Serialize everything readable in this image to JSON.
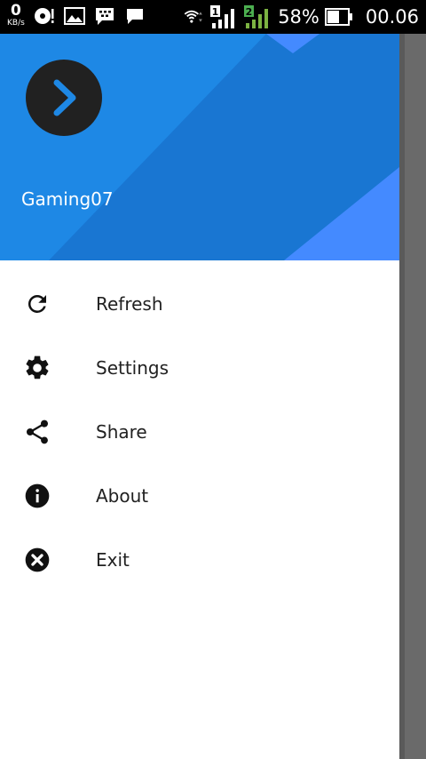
{
  "status_bar": {
    "net_speed_value": "0",
    "net_speed_unit": "KB/s",
    "sim1": "1",
    "sim2": "2",
    "battery_percent": "58%",
    "time": "00.06"
  },
  "drawer": {
    "username": "Gaming07",
    "colors": {
      "header_light": "#1e88e5",
      "header_dark": "#1976d2",
      "header_accent": "#448aff",
      "avatar_bg": "#212121",
      "avatar_chevron": "#1e88e5"
    },
    "menu": [
      {
        "label": "Refresh",
        "icon": "refresh-icon"
      },
      {
        "label": "Settings",
        "icon": "gear-icon"
      },
      {
        "label": "Share",
        "icon": "share-icon"
      },
      {
        "label": "About",
        "icon": "info-icon"
      },
      {
        "label": "Exit",
        "icon": "close-circle-icon"
      }
    ]
  }
}
